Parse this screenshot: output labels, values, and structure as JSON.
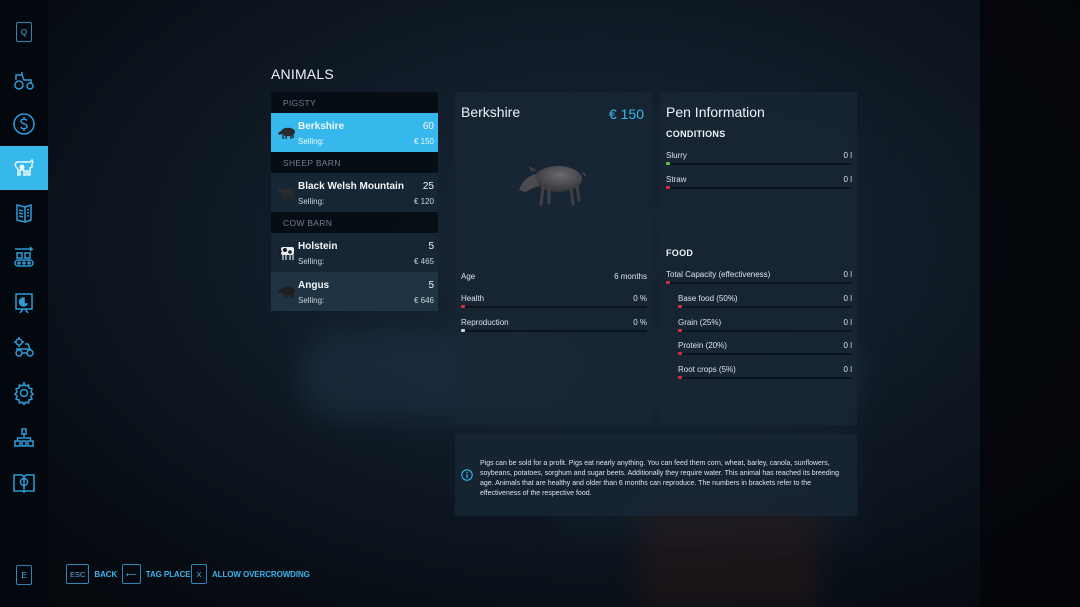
{
  "page": {
    "title": "ANIMALS"
  },
  "sidebar": {
    "top_key": "Q",
    "bottom_key": "E",
    "items": [
      {
        "icon": "tractor-icon",
        "active": false
      },
      {
        "icon": "finances-icon",
        "active": false
      },
      {
        "icon": "animals-icon",
        "active": true
      },
      {
        "icon": "contracts-icon",
        "active": false
      },
      {
        "icon": "production-icon",
        "active": false
      },
      {
        "icon": "statistics-icon",
        "active": false
      },
      {
        "icon": "garage-icon",
        "active": false
      },
      {
        "icon": "settings-icon",
        "active": false
      },
      {
        "icon": "multiplayer-icon",
        "active": false
      },
      {
        "icon": "help-icon",
        "active": false
      }
    ]
  },
  "animal_list": {
    "groups": [
      {
        "name": "PIGSTY",
        "animals": [
          {
            "name": "Berkshire",
            "count": "60",
            "selling_label": "Selling:",
            "selling_price": "€ 150",
            "selected": true
          }
        ]
      },
      {
        "name": "SHEEP BARN",
        "animals": [
          {
            "name": "Black Welsh Mountain",
            "count": "25",
            "selling_label": "Selling:",
            "selling_price": "€ 120",
            "selected": false
          }
        ]
      },
      {
        "name": "COW BARN",
        "animals": [
          {
            "name": "Holstein",
            "count": "5",
            "selling_label": "Selling:",
            "selling_price": "€ 465",
            "selected": false
          },
          {
            "name": "Angus",
            "count": "5",
            "selling_label": "Selling:",
            "selling_price": "€ 646",
            "selected": false
          }
        ]
      }
    ]
  },
  "detail": {
    "title": "Berkshire",
    "price": "€ 150",
    "stats": [
      {
        "label": "Age",
        "value": "6 months"
      },
      {
        "label": "Health",
        "value": "0 %",
        "fill": 0,
        "color": "#d2323c"
      },
      {
        "label": "Reproduction",
        "value": "0 %",
        "fill": 0,
        "color": "#c6d2dc"
      }
    ]
  },
  "pen": {
    "title": "Pen Information",
    "conditions_label": "CONDITIONS",
    "conditions": [
      {
        "label": "Slurry",
        "value": "0 l",
        "fill": 0,
        "color": "#5cc43c"
      },
      {
        "label": "Straw",
        "value": "0 l",
        "fill": 0,
        "color": "#d2323c"
      }
    ],
    "food_label": "FOOD",
    "food": [
      {
        "label": "Total Capacity (effectiveness)",
        "value": "0 l",
        "fill": 0,
        "color": "#d2323c"
      },
      {
        "label": "Base food (50%)",
        "value": "0 l",
        "fill": 0,
        "color": "#d2323c"
      },
      {
        "label": "Grain (25%)",
        "value": "0 l",
        "fill": 0,
        "color": "#d2323c"
      },
      {
        "label": "Protein (20%)",
        "value": "0 l",
        "fill": 0,
        "color": "#d2323c"
      },
      {
        "label": "Root crops (5%)",
        "value": "0 l",
        "fill": 0,
        "color": "#d2323c"
      }
    ]
  },
  "info": {
    "text": "Pigs can be sold for a profit. Pigs eat nearly anything. You can feed them corn, wheat, barley, canola, sunflowers, soybeans, potatoes, sorghum and sugar beets. Additionally they require water. This animal has reached its breeding age. Animals that are healthy and older than 6 months can reproduce. The numbers in brackets refer to the effectiveness of the respective food."
  },
  "footer": {
    "buttons": [
      {
        "key": "ESC",
        "label": "BACK"
      },
      {
        "key": "⟵",
        "label": "TAG PLACE"
      },
      {
        "key": "X",
        "label": "ALLOW OVERCROWDING"
      }
    ]
  },
  "colors": {
    "accent": "#36b8ec",
    "bad": "#d2323c",
    "good": "#5cc43c"
  }
}
